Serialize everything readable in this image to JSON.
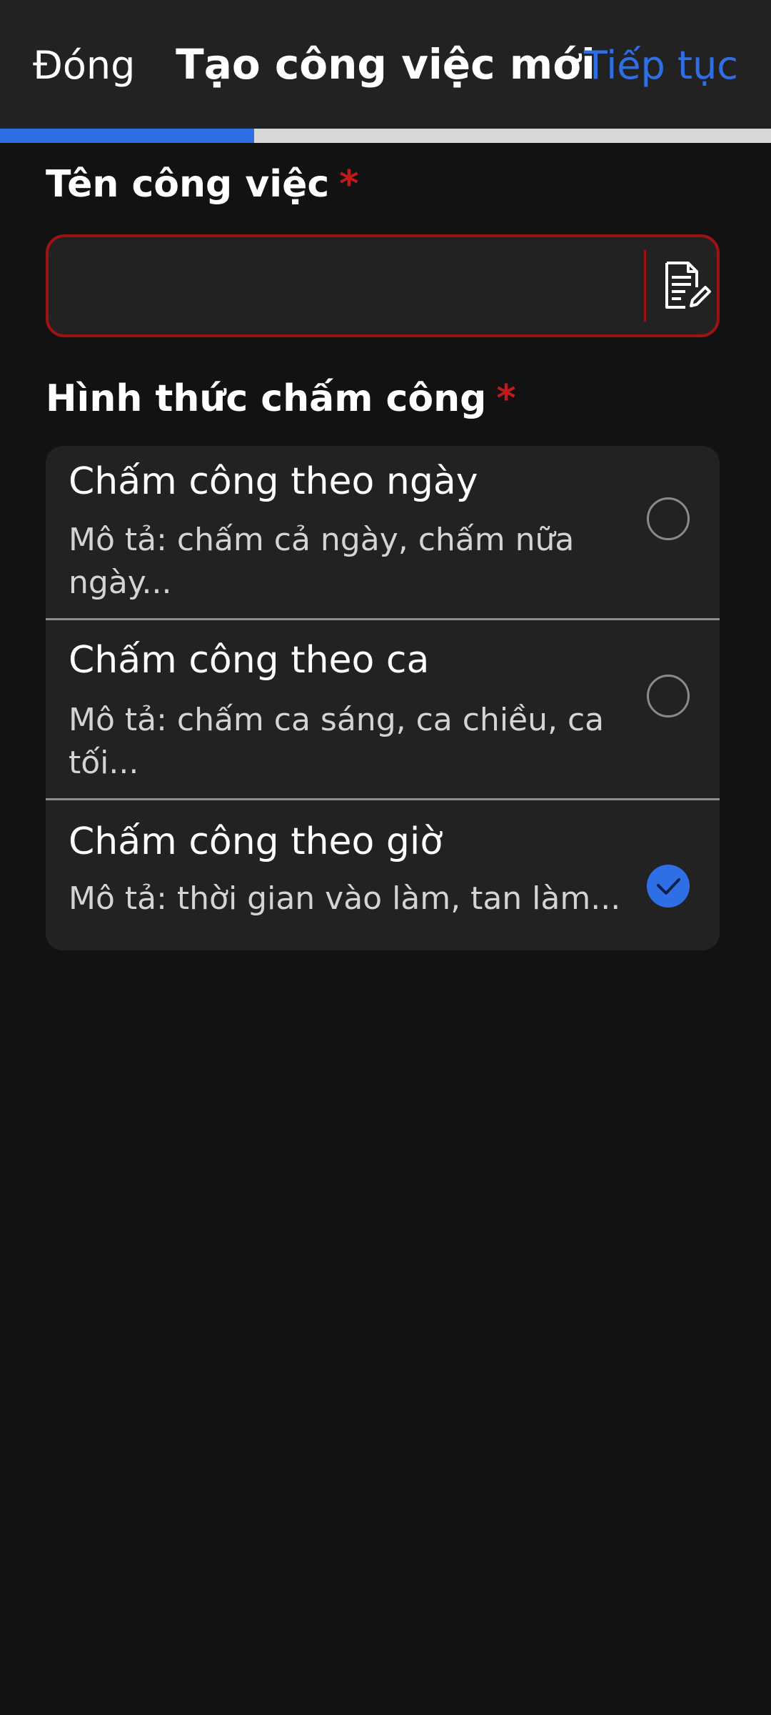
{
  "header": {
    "close_label": "Đóng",
    "title": "Tạo công việc mới",
    "continue_label": "Tiếp tục",
    "progress": 0.33
  },
  "form": {
    "job_name": {
      "label": "Tên công việc",
      "required_mark": "*",
      "value": "",
      "placeholder": "",
      "icon": "note-edit-icon"
    },
    "attendance_type": {
      "label": "Hình thức chấm công",
      "required_mark": "*",
      "options": [
        {
          "title": "Chấm công theo ngày",
          "description": "Mô tả: chấm cả ngày, chấm nữa ngày...",
          "selected": false
        },
        {
          "title": "Chấm công theo ca",
          "description": "Mô tả: chấm ca sáng, ca chiều, ca tối...",
          "selected": false
        },
        {
          "title": "Chấm công theo giờ",
          "description": "Mô tả: thời gian vào làm, tan làm...",
          "selected": true
        }
      ]
    }
  },
  "colors": {
    "accent": "#2f6fe6",
    "required": "#c21a1a",
    "background": "#121212",
    "surface": "#222223"
  }
}
